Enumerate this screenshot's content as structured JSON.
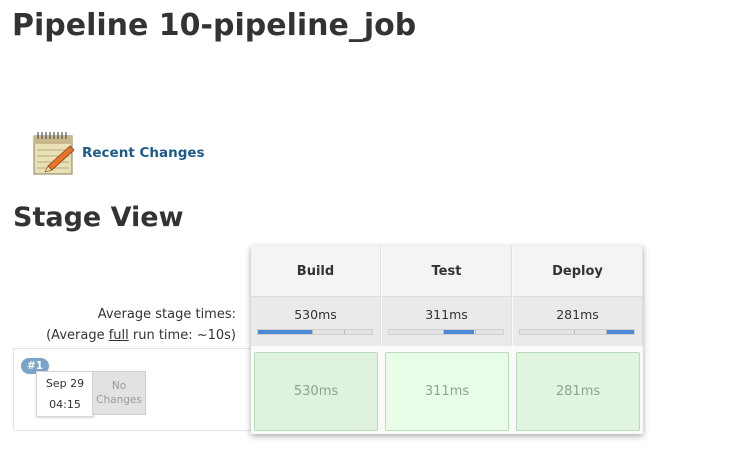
{
  "page": {
    "title": "Pipeline 10-pipeline_job"
  },
  "recent_changes": {
    "icon": "notepad-icon",
    "label": "Recent Changes"
  },
  "stage_view": {
    "title": "Stage View",
    "average_label": "Average stage times:",
    "full_runtime_prefix": "(Average ",
    "full_runtime_link": "full",
    "full_runtime_suffix": " run time: ~10s)",
    "stages": [
      {
        "name": "Build",
        "average": "530ms",
        "progress_start": 0.0,
        "progress_end": 0.47,
        "cell": "530ms"
      },
      {
        "name": "Test",
        "average": "311ms",
        "progress_start": 0.47,
        "progress_end": 0.75,
        "cell": "311ms"
      },
      {
        "name": "Deploy",
        "average": "281ms",
        "progress_start": 0.75,
        "progress_end": 1.0,
        "cell": "281ms"
      }
    ],
    "runs": [
      {
        "badge": "#1",
        "date": "Sep 29",
        "time": "04:15",
        "changes": "No Changes"
      }
    ],
    "colors": {
      "progress_fill": "#4a8ad4",
      "success_cell": "#def2de",
      "badge": "#7aa3c9"
    }
  }
}
